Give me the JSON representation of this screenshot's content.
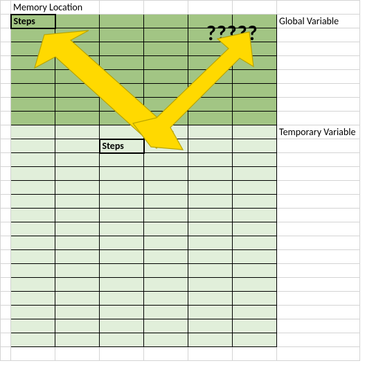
{
  "header": {
    "title": "Memory Location"
  },
  "labels": {
    "global": "Global Variable",
    "temporary": "Temporary Variable"
  },
  "cells": {
    "steps_top": "Steps",
    "steps_mid": "Steps"
  },
  "annotation": {
    "question": "?????"
  },
  "chart_data": {
    "type": "table",
    "title": "Memory Location",
    "regions": [
      {
        "name": "Global Variable",
        "rows": 8,
        "cols": 6,
        "fill": "#a2c584",
        "contains": [
          "Steps (row 1 col 1)"
        ]
      },
      {
        "name": "Temporary Variable",
        "rows": 16,
        "cols": 6,
        "fill": "#e1efda",
        "contains": [
          "Steps (row 2 col 3)"
        ]
      }
    ],
    "arrows": [
      {
        "from": "question-marks",
        "to": "Steps (Global)",
        "color": "#ffd900"
      },
      {
        "from": "question-marks",
        "to": "Steps (Temporary)",
        "color": "#ffd900"
      }
    ],
    "annotation_text": "?????"
  }
}
